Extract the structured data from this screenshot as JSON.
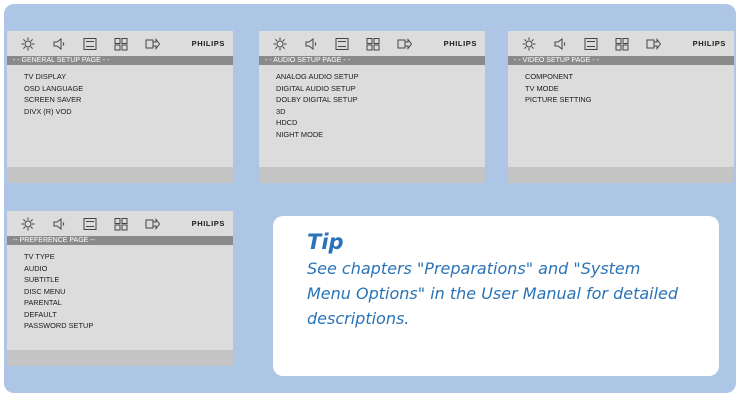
{
  "brand": "PHILIPS",
  "toolbar_icons": [
    "gear-icon",
    "speaker-icon",
    "monitor-icon",
    "grid-icon",
    "exit-icon"
  ],
  "panels": {
    "general": {
      "header": "- - GENERAL  SETUP  PAGE  - -",
      "items": [
        "TV DISPLAY",
        "OSD LANGUAGE",
        "SCREEN SAVER",
        "DIVX (R) VOD"
      ]
    },
    "audio": {
      "header": "- - AUDIO  SETUP  PAGE  - -",
      "items": [
        "ANALOG AUDIO SETUP",
        "DIGITAL AUDIO SETUP",
        "DOLBY DIGITAL SETUP",
        "3D",
        "HDCD",
        "NIGHT MODE"
      ]
    },
    "video": {
      "header": "- - VIDEO SETUP PAGE - -",
      "items": [
        "COMPONENT",
        "TV MODE",
        "PICTURE SETTING"
      ]
    },
    "preference": {
      "header": "-- PREFERENCE PAGE --",
      "items": [
        "TV TYPE",
        "AUDIO",
        "SUBTITLE",
        "DISC MENU",
        "PARENTAL",
        "DEFAULT",
        "PASSWORD SETUP"
      ]
    }
  },
  "tip": {
    "title": "Tip",
    "body": "See chapters \"Preparations\" and \"System Menu Options\" in the User Manual for detailed descriptions."
  },
  "colors": {
    "background": "#aec6e6",
    "panel": "#dcdcdc",
    "panel_header": "#8a8a8a",
    "panel_footer": "#c4c4c4",
    "tip_text": "#2a73b8"
  }
}
